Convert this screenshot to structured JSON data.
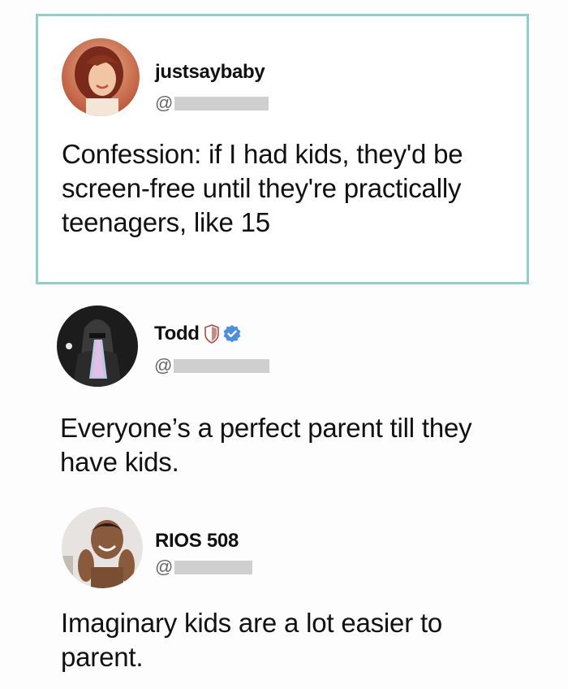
{
  "posts": [
    {
      "username": "justsaybaby",
      "handle_prefix": "@",
      "text": "Confession: if I had kids, they'd be screen-free until they're practically teenagers, like 15"
    },
    {
      "username": "Todd",
      "handle_prefix": "@",
      "text": "Everyone’s a perfect parent till they have kids."
    },
    {
      "username": "RIOS 508",
      "handle_prefix": "@",
      "text": "Imaginary kids are a lot easier to parent."
    }
  ],
  "colors": {
    "highlight_border": "#8ecfc9",
    "verified_badge": "#4a8fe0",
    "shield_badge": "#c98a86"
  }
}
